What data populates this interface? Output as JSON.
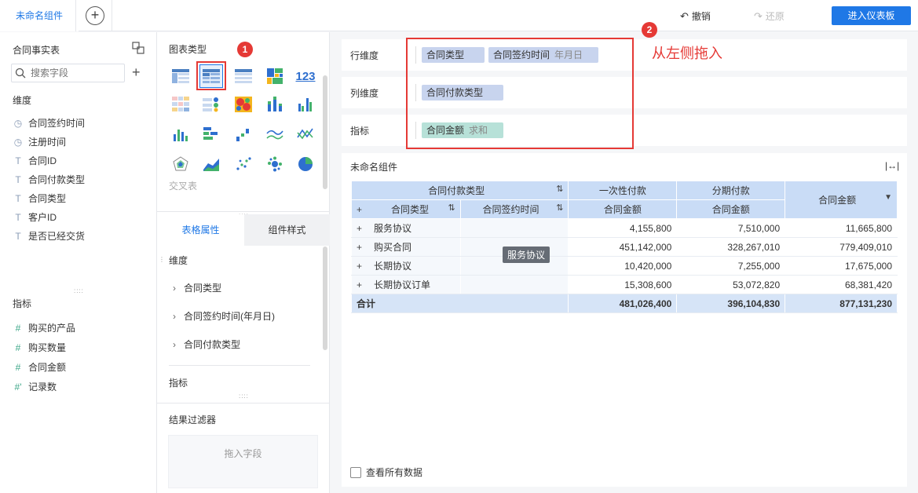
{
  "topbar": {
    "tab_label": "未命名组件",
    "add_tab": "+",
    "undo_label": "撤销",
    "redo_label": "还原",
    "enter_dashboard": "进入仪表板"
  },
  "fields_panel": {
    "table_name": "合同事实表",
    "search_placeholder": "搜索字段",
    "dimension_label": "维度",
    "dimensions": [
      {
        "icon": "◷",
        "name": "合同签约时间"
      },
      {
        "icon": "◷",
        "name": "注册时间"
      },
      {
        "icon": "T",
        "name": "合同ID"
      },
      {
        "icon": "T",
        "name": "合同付款类型"
      },
      {
        "icon": "T",
        "name": "合同类型"
      },
      {
        "icon": "T",
        "name": "客户ID"
      },
      {
        "icon": "T",
        "name": "是否已经交货"
      }
    ],
    "metric_label": "指标",
    "metrics": [
      {
        "icon": "#",
        "name": "购买的产品"
      },
      {
        "icon": "#",
        "name": "购买数量"
      },
      {
        "icon": "#",
        "name": "合同金额"
      },
      {
        "icon": "#'",
        "name": "记录数"
      }
    ]
  },
  "chart_panel": {
    "title": "图表类型",
    "badge1": "1",
    "cross_label": "交叉表",
    "tabs": [
      "表格属性",
      "组件样式"
    ],
    "prop_dimension_label": "维度",
    "prop_items": [
      "合同类型",
      "合同签约时间(年月日)",
      "合同付款类型"
    ],
    "prop_metric_label": "指标",
    "filter_title": "结果过滤器",
    "filter_placeholder": "拖入字段"
  },
  "config": {
    "row_label": "行维度",
    "row_pills": [
      {
        "text": "合同类型",
        "sub": ""
      },
      {
        "text": "合同签约时间",
        "sub": "年月日"
      }
    ],
    "col_label": "列维度",
    "col_pills": [
      {
        "text": "合同付款类型",
        "sub": ""
      }
    ],
    "metric_label": "指标",
    "metric_pills": [
      {
        "text": "合同金额",
        "sub": "求和"
      }
    ],
    "badge2": "2",
    "drag_hint": "从左侧拖入"
  },
  "table": {
    "widget_title": "未命名组件",
    "header_top": "合同付款类型",
    "header_row_dim1": "合同类型",
    "header_row_dim2": "合同签约时间",
    "col_groups": [
      "一次性付款",
      "分期付款"
    ],
    "col_metric": "合同金额",
    "total_col_header": "合同金额",
    "rows": [
      {
        "type": "服务协议",
        "v1": "4,155,800",
        "v2": "7,510,000",
        "total": "11,665,800"
      },
      {
        "type": "购买合同",
        "v1": "451,142,000",
        "v2": "328,267,010",
        "total": "779,409,010"
      },
      {
        "type": "长期协议",
        "v1": "10,420,000",
        "v2": "7,255,000",
        "total": "17,675,000"
      },
      {
        "type": "长期协议订单",
        "v1": "15,308,600",
        "v2": "53,072,820",
        "total": "68,381,420"
      }
    ],
    "total_row": {
      "label": "合计",
      "v1": "481,026,400",
      "v2": "396,104,830",
      "total": "877,131,230"
    },
    "tooltip": "服务协议",
    "view_all": "查看所有数据"
  },
  "colors": {
    "accent": "#1f78e6",
    "annotation_red": "#e53935",
    "dim_pill": "#c8d4ee",
    "metric_pill": "#b7e1d8",
    "header_bg": "#c9dcf6"
  }
}
